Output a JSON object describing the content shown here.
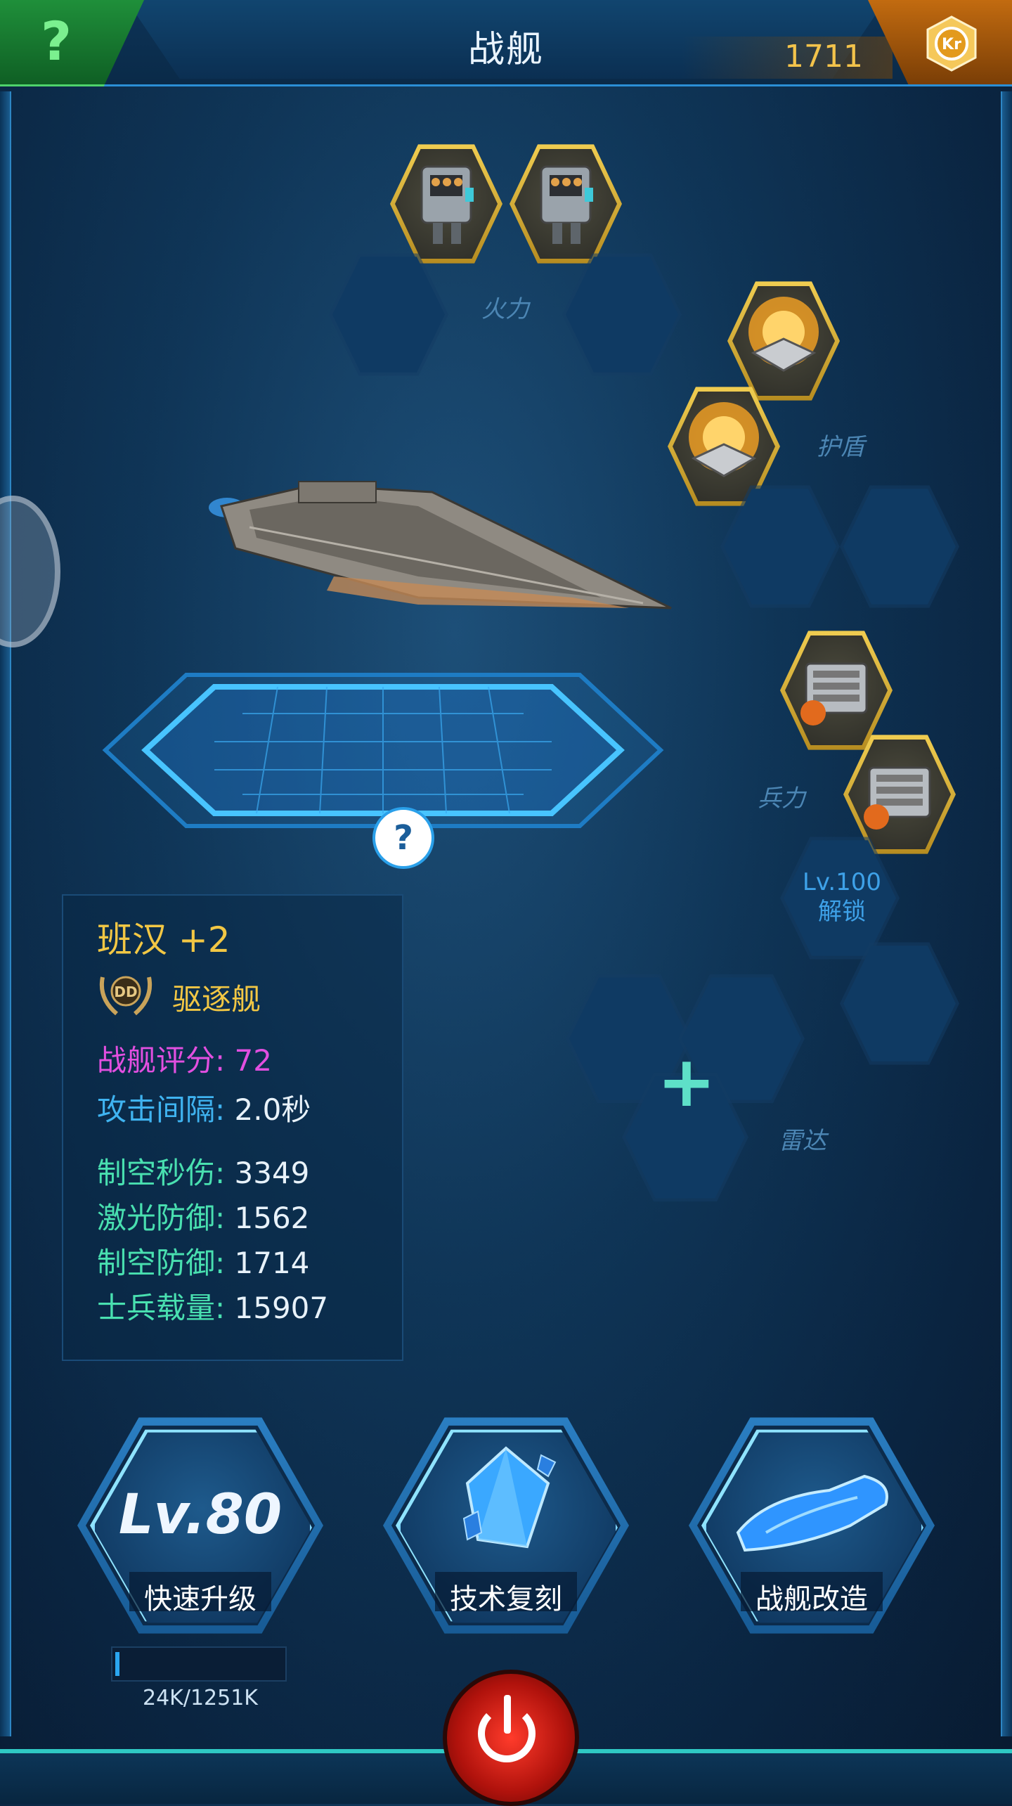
{
  "header": {
    "title": "战舰",
    "help_label": "?",
    "currency_value": "1711",
    "currency_icon": "kr-coin-icon"
  },
  "slots": {
    "firepower_label": "火力",
    "shield_label": "护盾",
    "troops_label": "兵力",
    "radar_label": "雷达",
    "lock_level": "Lv.100",
    "lock_text": "解锁"
  },
  "ship": {
    "name": "班汉 +2",
    "class_badge": "DD",
    "class_name": "驱逐舰",
    "pad_help": "?"
  },
  "stats": [
    {
      "label": "战舰评分:",
      "value": " 72",
      "color": "#e24fe0",
      "value_color": "#e24fe0"
    },
    {
      "label": "攻击间隔:",
      "value": " 2.0秒",
      "color": "#3fb3f0",
      "value_color": "#e8f2fa"
    },
    {
      "label": "制空秒伤:",
      "value": " 3349",
      "color": "#49e0b0",
      "value_color": "#e8f2fa"
    },
    {
      "label": "激光防御:",
      "value": " 1562",
      "color": "#49e0b0",
      "value_color": "#e8f2fa"
    },
    {
      "label": "制空防御:",
      "value": " 1714",
      "color": "#49e0b0",
      "value_color": "#e8f2fa"
    },
    {
      "label": "士兵载量:",
      "value": " 15907",
      "color": "#49e0b0",
      "value_color": "#e8f2fa"
    }
  ],
  "actions": {
    "upgrade": {
      "level": "Lv.80",
      "label": "快速升级"
    },
    "tech": {
      "label": "技术复刻"
    },
    "refit": {
      "label": "战舰改造"
    }
  },
  "progress": {
    "text": "24K/1251K",
    "fraction": 0.019
  },
  "radar_plus": "+",
  "colors": {
    "accent_blue": "#2b8fd6",
    "gold": "#f2c744",
    "teal": "#2fc9c4"
  }
}
